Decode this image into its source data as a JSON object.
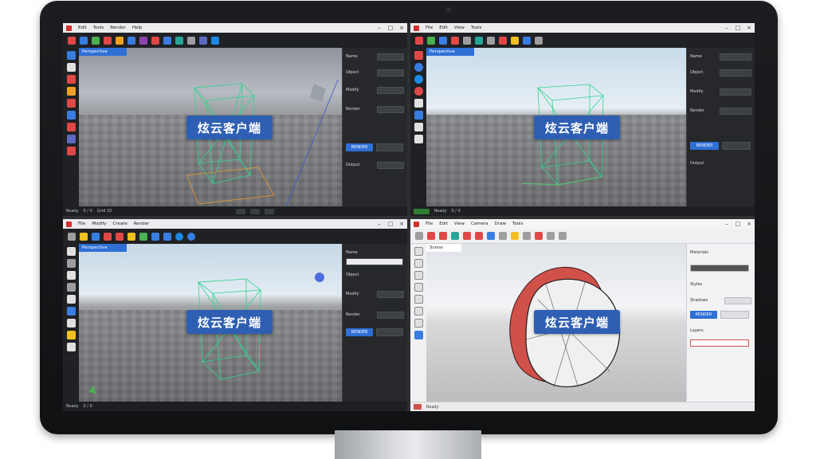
{
  "scene": {
    "overlay_label": "炫云客户端"
  },
  "windows": [
    {
      "id": "top-left",
      "theme": "dark",
      "menu": [
        "Edit",
        "Tools",
        "Render",
        "Help"
      ],
      "viewport_tab": "Perspective",
      "right_panel": {
        "rows": [
          "Name",
          "Object",
          "Modify",
          "Render",
          "Output"
        ],
        "primary_button": "RENDER"
      },
      "status": [
        "Ready",
        "0 / 0",
        "Grid 10"
      ]
    },
    {
      "id": "top-right",
      "theme": "dark",
      "menu": [
        "File",
        "Edit",
        "View",
        "Tools"
      ],
      "viewport_tab": "Perspective",
      "right_panel": {
        "rows": [
          "Name",
          "Object",
          "Modify",
          "Render",
          "Output"
        ],
        "primary_button": "RENDER"
      },
      "status": [
        "Ready",
        "0 / 0"
      ]
    },
    {
      "id": "bottom-left",
      "theme": "dark",
      "menu": [
        "File",
        "Modify",
        "Create",
        "Render"
      ],
      "viewport_tab": "Perspective",
      "right_panel": {
        "rows": [
          "Name",
          "Object",
          "Modify",
          "Render"
        ],
        "primary_button": "RENDER"
      },
      "status": [
        "Ready",
        "0 / 0"
      ]
    },
    {
      "id": "bottom-right",
      "theme": "light",
      "menu": [
        "File",
        "Edit",
        "View",
        "Camera",
        "Draw",
        "Tools"
      ],
      "viewport_tab": "Scene",
      "right_panel": {
        "rows": [
          "Materials",
          "Styles",
          "Shadows",
          "Layers"
        ],
        "primary_button": "RENDER"
      },
      "status": [
        "Ready"
      ]
    }
  ],
  "colors": {
    "accent_blue": "#2f6fd6",
    "badge_blue": "#2e5fb3",
    "wire_green": "#2fd48f",
    "gizmo_orange": "#e79a2a",
    "surface_red": "#d0504a"
  }
}
